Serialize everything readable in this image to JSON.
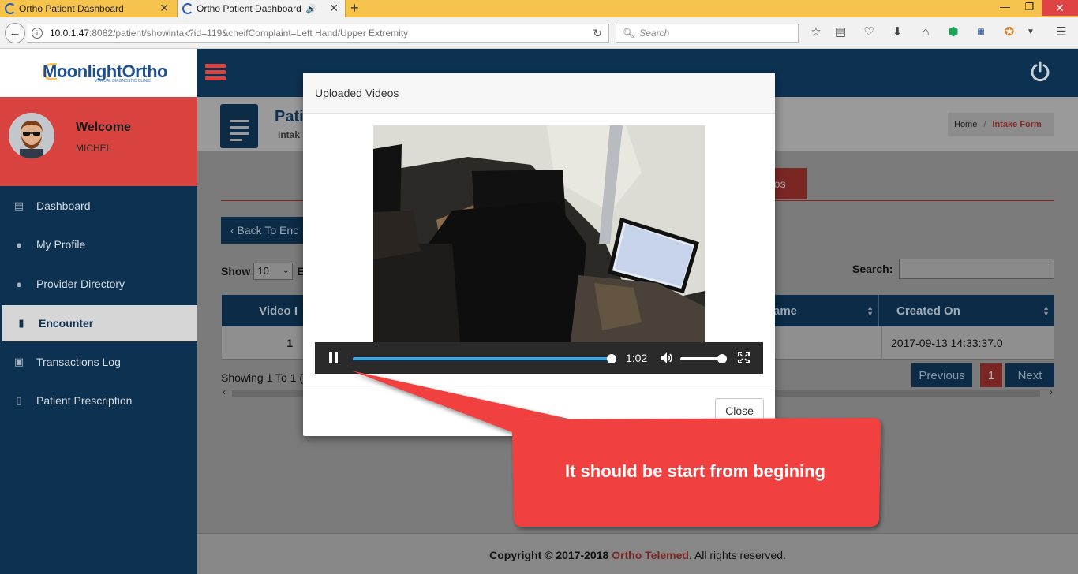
{
  "browser": {
    "tabs": [
      {
        "title": "Ortho Patient Dashboard",
        "active": false
      },
      {
        "title": "Ortho Patient Dashboard",
        "active": true,
        "audio": true
      }
    ],
    "url_host": "10.0.1.47",
    "url_path": ":8082/patient/showintak?id=119&cheifComplaint=Left Hand/Upper Extremity",
    "search_placeholder": "Search"
  },
  "app": {
    "logo_text": "MoonlightOrtho",
    "logo_sub": "VIRTUAL DIAGNOSTIC CLINIC",
    "colors": {
      "navy": "#0d3151",
      "red": "#d9433f"
    }
  },
  "sidebar": {
    "welcome": "Welcome",
    "user": "MICHEL",
    "items": [
      {
        "label": "Dashboard",
        "icon": "dashboard-icon"
      },
      {
        "label": "My Profile",
        "icon": "user-icon"
      },
      {
        "label": "Provider Directory",
        "icon": "user-md-icon"
      },
      {
        "label": "Encounter",
        "icon": "file-icon",
        "active": true
      },
      {
        "label": "Transactions Log",
        "icon": "money-icon"
      },
      {
        "label": "Patient Prescription",
        "icon": "file-text-icon"
      }
    ]
  },
  "page": {
    "title_partial": "Pati",
    "subtitle_partial": "Intak",
    "breadcrumb": {
      "home": "Home",
      "sep": "/",
      "current": "Intake Form"
    },
    "tab_partial": "eos",
    "back_button_partial": "‹ Back To Enc",
    "show_label": "Show",
    "show_value": "10",
    "show_after": "E",
    "search_label": "Search:",
    "table": {
      "headers": [
        "Video I",
        "ame",
        "Created On"
      ],
      "row": {
        "num": "1",
        "created": "2017-09-13 14:33:37.0"
      }
    },
    "showing_partial": "Showing 1 To 1 (",
    "pagination": {
      "prev": "Previous",
      "page": "1",
      "next": "Next"
    }
  },
  "footer": {
    "prefix": "Copyright © 2017-2018 ",
    "brand": "Ortho Telemed",
    "suffix": ". All rights reserved."
  },
  "modal": {
    "title": "Uploaded Videos",
    "player": {
      "time": "1:02",
      "progress": 1.0,
      "volume": 0.92
    },
    "close_label": "Close"
  },
  "annotation": {
    "text": "It should be start from begining",
    "color": "#f04040"
  }
}
